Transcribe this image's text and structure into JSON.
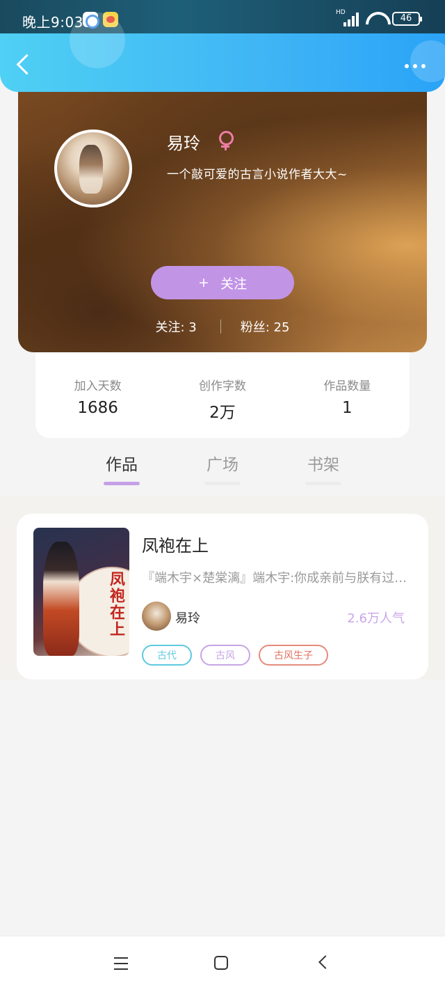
{
  "status_bar": {
    "time": "晚上9:03",
    "network_label": "HD",
    "battery": "46"
  },
  "profile": {
    "name": "易玲",
    "gender": "female",
    "bio": "一个敲可爱的古言小说作者大大~",
    "follow_plus": "+",
    "follow_label": "关注",
    "following": "关注: 3",
    "fans": "粉丝: 25"
  },
  "stats": [
    {
      "label": "加入天数",
      "value": "1686"
    },
    {
      "label": "创作字数",
      "value": "2万"
    },
    {
      "label": "作品数量",
      "value": "1"
    }
  ],
  "tabs": [
    {
      "label": "作品",
      "active": true
    },
    {
      "label": "广场",
      "active": false
    },
    {
      "label": "书架",
      "active": false
    }
  ],
  "book": {
    "title": "凤袍在上",
    "cover_text": "凤袍在上",
    "description": "『端木宇×楚棠漓』端木宇:你成亲前与朕有过一段",
    "author": "易玲",
    "popularity": "2.6万人气",
    "tags": [
      {
        "label": "古代",
        "color": "#5ec8e0"
      },
      {
        "label": "古风",
        "color": "#c8a4e6"
      },
      {
        "label": "古风生子",
        "color": "#e48b7c"
      }
    ]
  },
  "colors": {
    "accent_purple": "#c294e6",
    "nav_blue": "#3fb5f5",
    "gender_pink": "#ef7da6"
  }
}
